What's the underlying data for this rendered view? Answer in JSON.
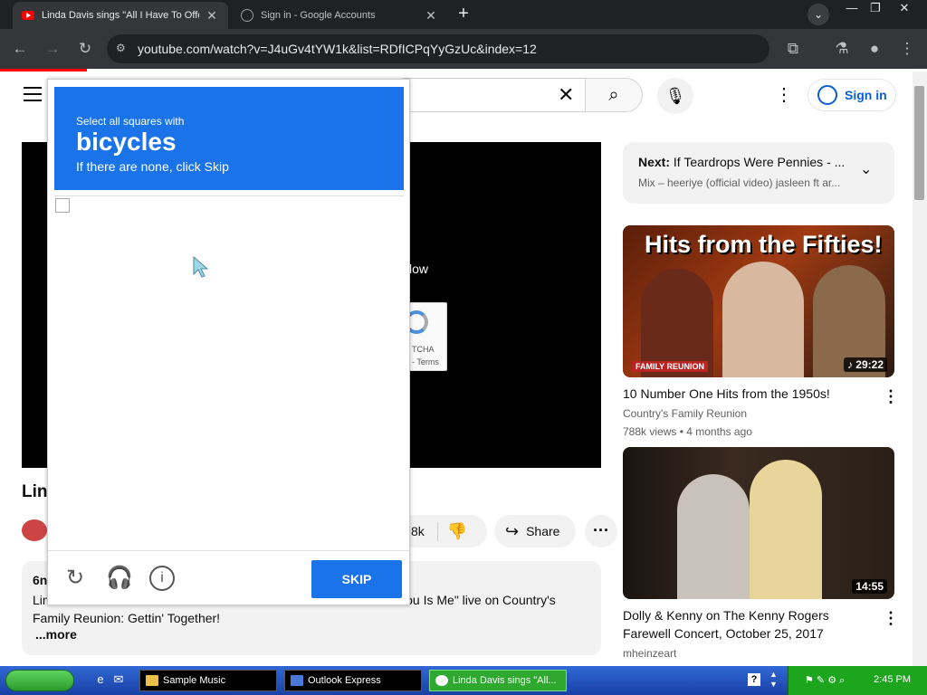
{
  "browser": {
    "tabs": [
      {
        "title": "Linda Davis sings \"All I Have To Offer You Is Me\"",
        "favicon": "youtube-icon",
        "active": true
      },
      {
        "title": "Sign in - Google Accounts",
        "favicon": "globe-icon",
        "active": false
      }
    ],
    "url": "youtube.com/watch?v=J4uGv4tYW1k&list=RDfICPqYyGzUc&index=12"
  },
  "youtube": {
    "signin_label": "Sign in",
    "video_title_partial": "Lin",
    "like_count_partial": "8k",
    "share_label": "Share",
    "description": {
      "views_partial": "6n",
      "line_start": "Lin",
      "line_end": "er You Is Me\" live on Country's",
      "line2": "Family Reunion: Gettin' Together!",
      "more_label": "...more"
    },
    "player_overlay_text": "low",
    "recaptcha_badge": {
      "label": "TCHA",
      "terms": "- Terms"
    },
    "next": {
      "label": "Next:",
      "title": "If Teardrops Were Pennies - ...",
      "subtitle": "Mix – heeriye (official video) jasleen  ft ar..."
    },
    "recommendations": [
      {
        "thumb_text": "Hits from the Fifties!",
        "thumb_badge": "FAMILY REUNION",
        "duration": "29:22",
        "title": "10 Number One Hits from the 1950s!",
        "channel": "Country's Family Reunion",
        "meta": "788k views • 4 months ago"
      },
      {
        "duration": "14:55",
        "title": "Dolly & Kenny on The Kenny Rogers Farewell Concert, October 25, 2017",
        "channel": "mheinzeart"
      }
    ]
  },
  "captcha": {
    "select_text": "Select all squares with",
    "object": "bicycles",
    "none_text": "If there are none, click Skip",
    "skip_label": "SKIP"
  },
  "taskbar": {
    "items": [
      "Sample Music",
      "Outlook Express",
      "Linda Davis sings \"All..."
    ],
    "clock": "2:45 PM"
  },
  "colors": {
    "youtube_red": "#ff0000",
    "captcha_blue": "#1a73e8",
    "link_blue": "#065fd4"
  }
}
